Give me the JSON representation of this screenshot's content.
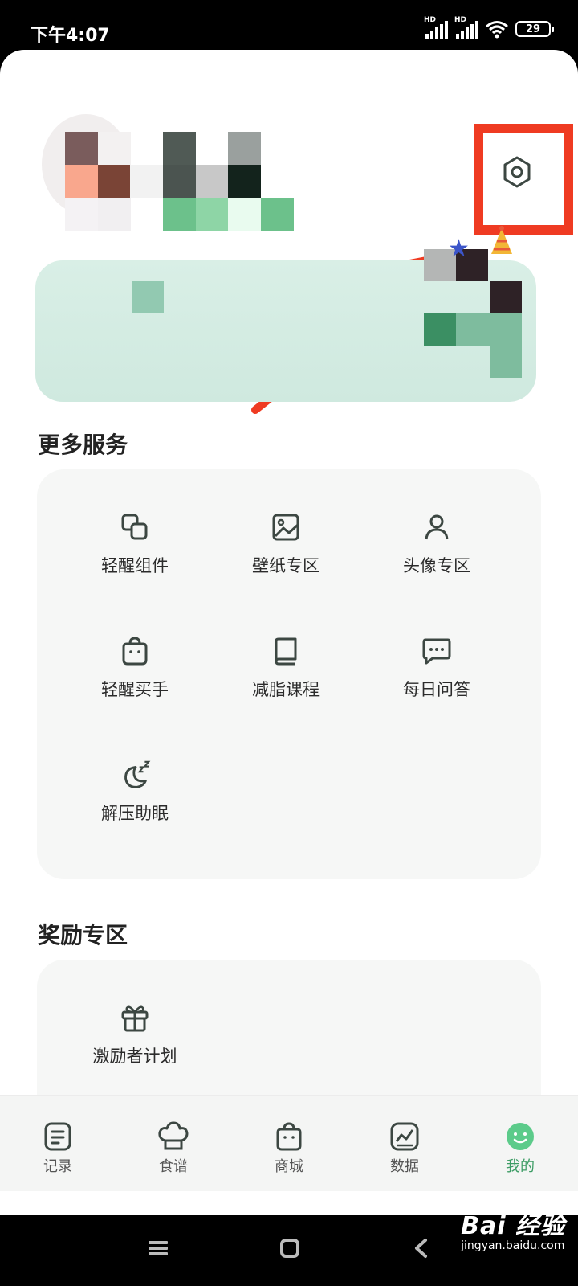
{
  "status_bar": {
    "time": "下午4:07",
    "signal_badge": "HD",
    "battery": "29"
  },
  "services": {
    "title": "更多服务",
    "items": [
      {
        "label": "轻醒组件",
        "icon": "widget-icon"
      },
      {
        "label": "壁纸专区",
        "icon": "image-icon"
      },
      {
        "label": "头像专区",
        "icon": "person-icon"
      },
      {
        "label": "轻醒买手",
        "icon": "shopping-bag-icon"
      },
      {
        "label": "减脂课程",
        "icon": "book-icon"
      },
      {
        "label": "每日问答",
        "icon": "chat-icon"
      },
      {
        "label": "解压助眠",
        "icon": "moon-sleep-icon"
      }
    ]
  },
  "rewards": {
    "title": "奖励专区",
    "items": [
      {
        "label": "激励者计划",
        "icon": "gift-icon"
      }
    ]
  },
  "tabbar": {
    "items": [
      {
        "label": "记录",
        "icon": "record-icon"
      },
      {
        "label": "食谱",
        "icon": "chef-hat-icon"
      },
      {
        "label": "商城",
        "icon": "shopping-bag-icon"
      },
      {
        "label": "数据",
        "icon": "chart-icon"
      },
      {
        "label": "我的",
        "icon": "smile-icon"
      }
    ],
    "active_index": 4
  },
  "watermark": {
    "main": "Bai 经验",
    "sub": "jingyan.baidu.com"
  },
  "colors": {
    "accent": "#3c9c64",
    "annotation": "#ef3b22",
    "banner": "#d5ede3"
  }
}
